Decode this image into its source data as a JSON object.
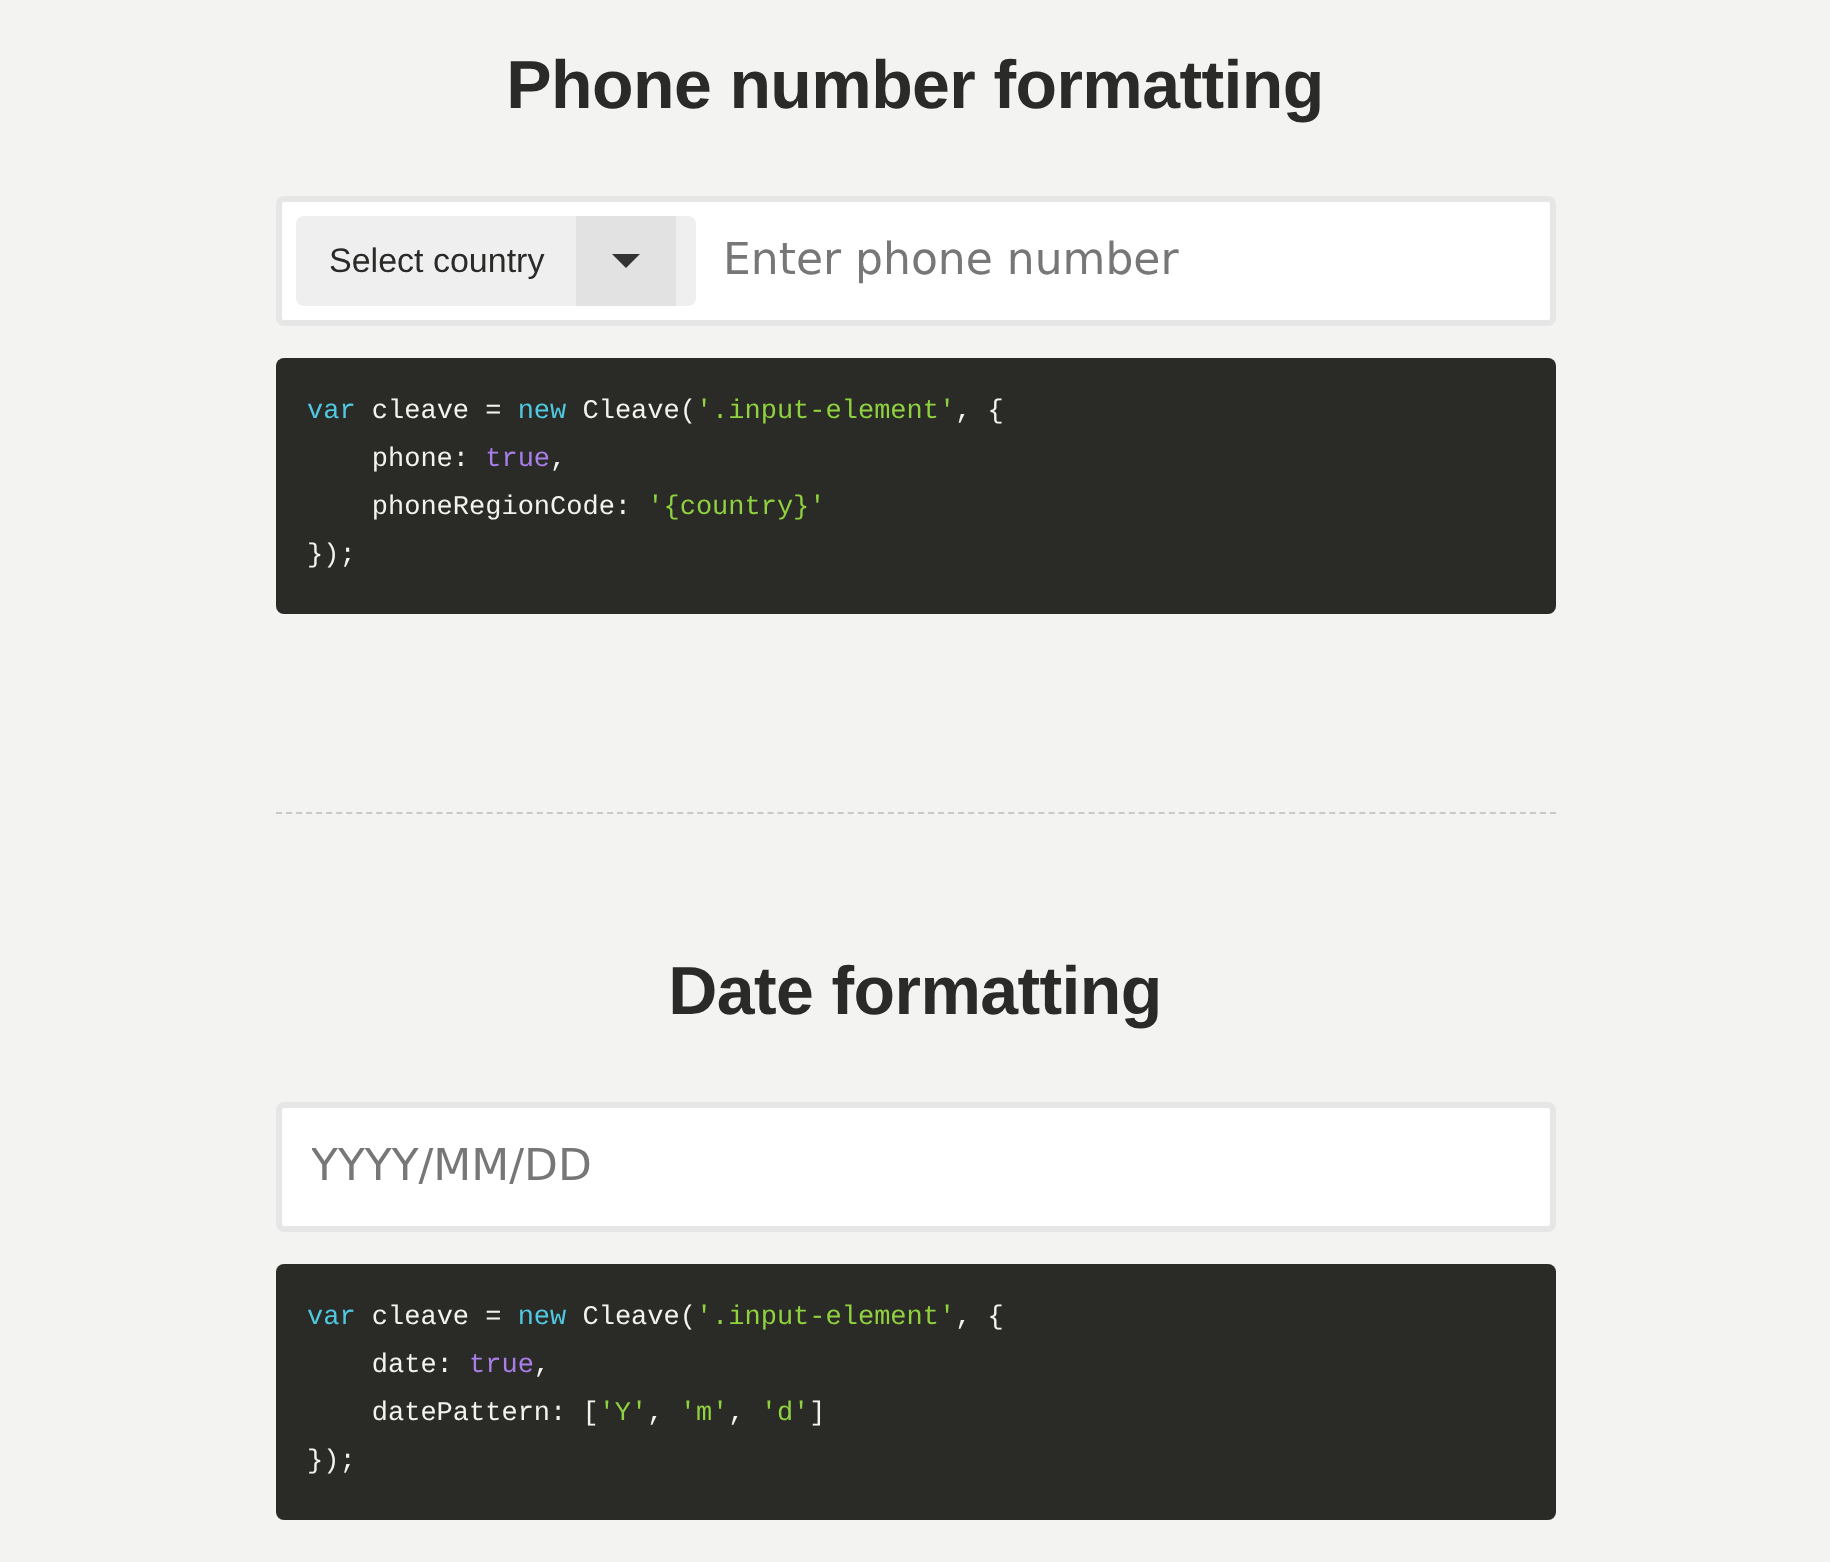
{
  "sections": [
    {
      "title": "Phone number formatting",
      "field": {
        "prefix": {
          "kind": "select",
          "label": "Select country"
        },
        "placeholder": "Enter phone number"
      },
      "code": [
        [
          {
            "kind": "keyword",
            "text": "var"
          },
          {
            "kind": "plain",
            "text": " cleave = "
          },
          {
            "kind": "keyword",
            "text": "new"
          },
          {
            "kind": "plain",
            "text": " Cleave("
          },
          {
            "kind": "string",
            "text": "'.input-element'"
          },
          {
            "kind": "plain",
            "text": ", {"
          }
        ],
        [
          {
            "kind": "plain",
            "text": "    phone: "
          },
          {
            "kind": "boolean",
            "text": "true"
          },
          {
            "kind": "plain",
            "text": ","
          }
        ],
        [
          {
            "kind": "plain",
            "text": "    phoneRegionCode: "
          },
          {
            "kind": "string",
            "text": "'{country}'"
          }
        ],
        [
          {
            "kind": "plain",
            "text": "});"
          }
        ]
      ]
    },
    {
      "title": "Date formatting",
      "field": {
        "placeholder": "YYYY/MM/DD"
      },
      "code": [
        [
          {
            "kind": "keyword",
            "text": "var"
          },
          {
            "kind": "plain",
            "text": " cleave = "
          },
          {
            "kind": "keyword",
            "text": "new"
          },
          {
            "kind": "plain",
            "text": " Cleave("
          },
          {
            "kind": "string",
            "text": "'.input-element'"
          },
          {
            "kind": "plain",
            "text": ", {"
          }
        ],
        [
          {
            "kind": "plain",
            "text": "    date: "
          },
          {
            "kind": "boolean",
            "text": "true"
          },
          {
            "kind": "plain",
            "text": ","
          }
        ],
        [
          {
            "kind": "plain",
            "text": "    datePattern: ["
          },
          {
            "kind": "string",
            "text": "'Y'"
          },
          {
            "kind": "plain",
            "text": ", "
          },
          {
            "kind": "string",
            "text": "'m'"
          },
          {
            "kind": "plain",
            "text": ", "
          },
          {
            "kind": "string",
            "text": "'d'"
          },
          {
            "kind": "plain",
            "text": "]"
          }
        ],
        [
          {
            "kind": "plain",
            "text": "});"
          }
        ]
      ]
    }
  ]
}
